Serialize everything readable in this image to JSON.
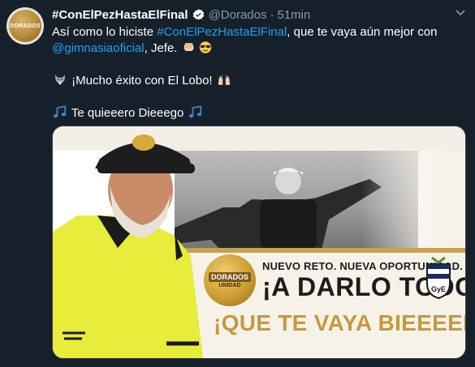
{
  "tweet": {
    "author": "#ConElPezHastaElFinal",
    "handle": "@Dorados",
    "separator": "·",
    "time": "51min",
    "line1_prefix": "Así como lo hiciste ",
    "line1_hashtag": "#ConElPezHastaElFinal",
    "line1_suffix": ", que te vaya aún mejor con",
    "line2_mention": "@gimnasiaoficial",
    "line2_suffix": ", Jefe.",
    "line3_text": "¡Mucho éxito con El Lobo!",
    "line4_text": "Te quieeero Dieeego"
  },
  "avatar": {
    "label": "DORADOS"
  },
  "media": {
    "caption_small": "NUEVO RETO. NUEVA OPORTUNIDAD.",
    "caption_big": "¡A DARLO TODO!",
    "caption_gold": "¡QUE TE VAYA BIEEEEEN CHILO!",
    "logo_label": "DORADOS",
    "logo_sub": "UNIDAD"
  },
  "colors": {
    "background": "#15202b",
    "link": "#1da1f2",
    "muted": "#8899a6",
    "gold": "#c49a3f"
  },
  "icons": [
    "verified-badge-icon",
    "chevron-down-icon",
    "fist-emoji-icon",
    "sunglasses-emoji-icon",
    "wolf-emoji-icon",
    "raised-hands-emoji-icon",
    "music-note-icon"
  ]
}
